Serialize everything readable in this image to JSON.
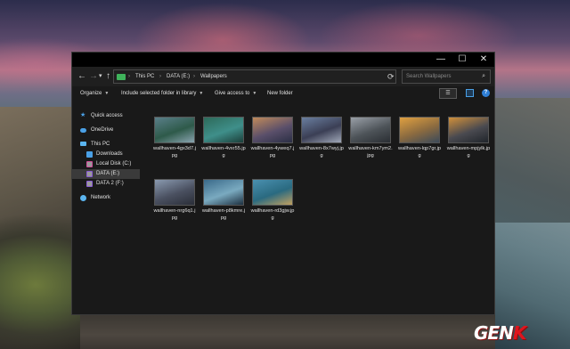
{
  "window": {
    "controls": {
      "minimize": "—",
      "maximize": "☐",
      "close": "✕"
    }
  },
  "address_bar": {
    "back": "←",
    "forward": "→",
    "recent": "▾",
    "up": "↑",
    "path": [
      "This PC",
      "DATA (E:)",
      "Wallpapers"
    ],
    "separator": "›",
    "dropdown": "⌄",
    "refresh": "⟳",
    "search_placeholder": "Search Wallpapers",
    "search_icon": "⌕"
  },
  "command_bar": {
    "organize": "Organize",
    "include": "Include selected folder in library",
    "give_access": "Give access to",
    "new_folder": "New folder",
    "caret": "▼",
    "view_icon": "☰",
    "help": "?"
  },
  "nav_pane": {
    "items": [
      {
        "label": "Quick access",
        "icon": "star-icon",
        "color": "#4aa0e6"
      },
      {
        "label": "OneDrive",
        "icon": "cloud-icon",
        "color": "#4aa0e6"
      },
      {
        "label": "This PC",
        "icon": "computer-icon",
        "color": "#5bb5f0"
      },
      {
        "label": "Downloads",
        "icon": "download-icon",
        "color": "#4aa0e6"
      },
      {
        "label": "Local Disk (C:)",
        "icon": "drive-icon",
        "color": "#c0c0c0"
      },
      {
        "label": "DATA (E:)",
        "icon": "drive-icon",
        "color": "#c0c0c0",
        "selected": true
      },
      {
        "label": "DATA 2 (F:)",
        "icon": "drive-icon",
        "color": "#c0c0c0"
      },
      {
        "label": "Network",
        "icon": "network-icon",
        "color": "#5bb5f0"
      }
    ]
  },
  "files": [
    {
      "name": "wallhaven-4gx3d7.jpg",
      "colors": [
        "#5a7f8a",
        "#2e5a4a",
        "#8aa4b0"
      ]
    },
    {
      "name": "wallhaven-4vxr55.jpg",
      "colors": [
        "#2d6a5a",
        "#3f8f8a",
        "#1c3f3a"
      ]
    },
    {
      "name": "wallhaven-4yweq7.jpg",
      "colors": [
        "#c08a5a",
        "#5a4f6a",
        "#2b2f45"
      ]
    },
    {
      "name": "wallhaven-8x7wyj.jpg",
      "colors": [
        "#6a7fa0",
        "#3b3f55",
        "#a0a8b8"
      ]
    },
    {
      "name": "wallhaven-km7ym2.jpg",
      "colors": [
        "#9aa0a8",
        "#4d5358",
        "#2a2e33"
      ]
    },
    {
      "name": "wallhaven-lqp7gr.jpg",
      "colors": [
        "#e0a040",
        "#8a6a40",
        "#3b4a5a"
      ]
    },
    {
      "name": "wallhaven-mpjylk.jpg",
      "colors": [
        "#d0903a",
        "#4a4a50",
        "#20252b"
      ]
    },
    {
      "name": "wallhaven-nrg6q1.jpg",
      "colors": [
        "#8a9ab0",
        "#4a5060",
        "#2a2e38"
      ]
    },
    {
      "name": "wallhaven-p8kmre.jpg",
      "colors": [
        "#3a6a8a",
        "#7aaac0",
        "#1d3040"
      ]
    },
    {
      "name": "wallhaven-rd3gjw.jpg",
      "colors": [
        "#4a90b0",
        "#2a6a80",
        "#c0a060"
      ]
    }
  ],
  "watermark": {
    "text_main": "GEN",
    "text_accent": "K"
  }
}
